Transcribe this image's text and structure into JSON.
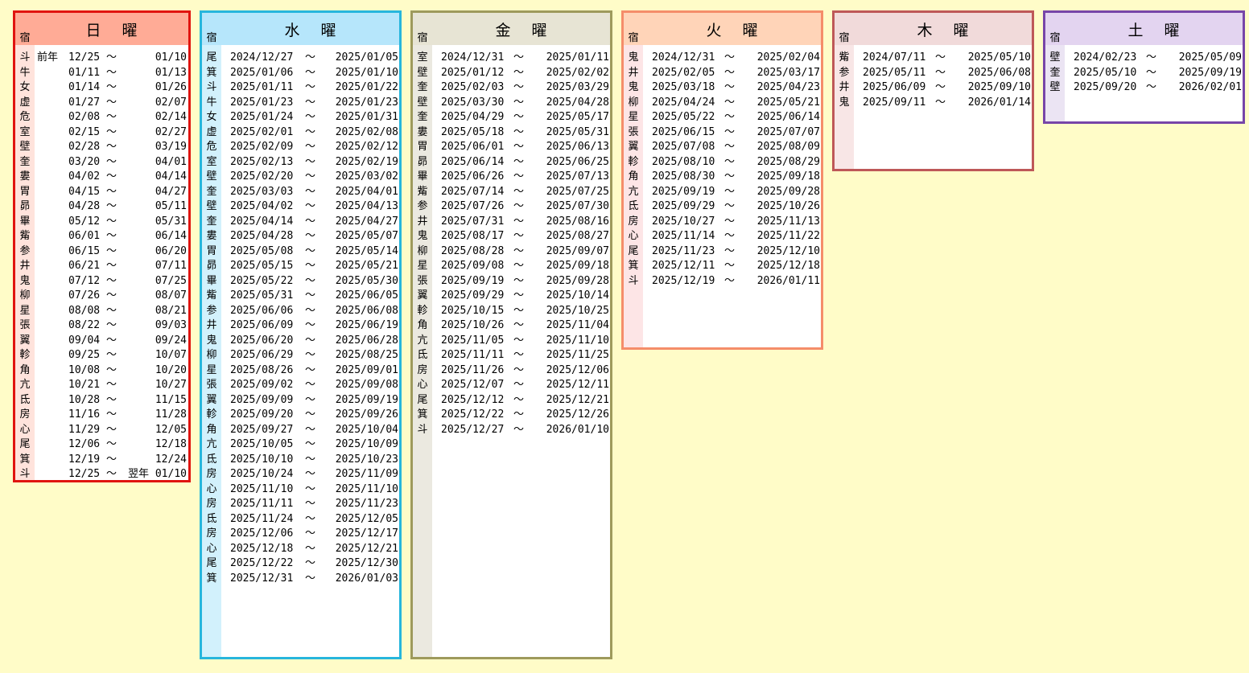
{
  "labels": {
    "syuku": "宿",
    "tilde": "〜"
  },
  "colors": {
    "background": "#fffcc8",
    "sunday": {
      "border": "#e0140f",
      "header": "#ffab96",
      "stripe": "#ffe3dc"
    },
    "wednesday": {
      "border": "#27b6dc",
      "header": "#b6e6fb",
      "stripe": "#d2f1fc"
    },
    "friday": {
      "border": "#9e9a5c",
      "header": "#e7e4d4",
      "stripe": "#ebe9e0"
    },
    "tuesday": {
      "border": "#f58d6a",
      "header": "#ffd4b8",
      "stripe": "#fde5e6"
    },
    "thursday": {
      "border": "#be5858",
      "header": "#f1dada",
      "stripe": "#f8e6e6"
    },
    "saturday": {
      "border": "#7745a8",
      "header": "#e3d4f0",
      "stripe": "#ebe4f3"
    }
  },
  "sunday": {
    "title": "日曜",
    "rows": [
      {
        "m": "斗",
        "pre": "前年",
        "s": "12/25 〜",
        "e": "01/10"
      },
      {
        "m": "牛",
        "pre": "",
        "s": "01/11 〜",
        "e": "01/13"
      },
      {
        "m": "女",
        "pre": "",
        "s": "01/14 〜",
        "e": "01/26"
      },
      {
        "m": "虚",
        "pre": "",
        "s": "01/27 〜",
        "e": "02/07"
      },
      {
        "m": "危",
        "pre": "",
        "s": "02/08 〜",
        "e": "02/14"
      },
      {
        "m": "室",
        "pre": "",
        "s": "02/15 〜",
        "e": "02/27"
      },
      {
        "m": "壁",
        "pre": "",
        "s": "02/28 〜",
        "e": "03/19"
      },
      {
        "m": "奎",
        "pre": "",
        "s": "03/20 〜",
        "e": "04/01"
      },
      {
        "m": "婁",
        "pre": "",
        "s": "04/02 〜",
        "e": "04/14"
      },
      {
        "m": "胃",
        "pre": "",
        "s": "04/15 〜",
        "e": "04/27"
      },
      {
        "m": "昴",
        "pre": "",
        "s": "04/28 〜",
        "e": "05/11"
      },
      {
        "m": "畢",
        "pre": "",
        "s": "05/12 〜",
        "e": "05/31"
      },
      {
        "m": "觜",
        "pre": "",
        "s": "06/01 〜",
        "e": "06/14"
      },
      {
        "m": "参",
        "pre": "",
        "s": "06/15 〜",
        "e": "06/20"
      },
      {
        "m": "井",
        "pre": "",
        "s": "06/21 〜",
        "e": "07/11"
      },
      {
        "m": "鬼",
        "pre": "",
        "s": "07/12 〜",
        "e": "07/25"
      },
      {
        "m": "柳",
        "pre": "",
        "s": "07/26 〜",
        "e": "08/07"
      },
      {
        "m": "星",
        "pre": "",
        "s": "08/08 〜",
        "e": "08/21"
      },
      {
        "m": "張",
        "pre": "",
        "s": "08/22 〜",
        "e": "09/03"
      },
      {
        "m": "翼",
        "pre": "",
        "s": "09/04 〜",
        "e": "09/24"
      },
      {
        "m": "軫",
        "pre": "",
        "s": "09/25 〜",
        "e": "10/07"
      },
      {
        "m": "角",
        "pre": "",
        "s": "10/08 〜",
        "e": "10/20"
      },
      {
        "m": "亢",
        "pre": "",
        "s": "10/21 〜",
        "e": "10/27"
      },
      {
        "m": "氐",
        "pre": "",
        "s": "10/28 〜",
        "e": "11/15"
      },
      {
        "m": "房",
        "pre": "",
        "s": "11/16 〜",
        "e": "11/28"
      },
      {
        "m": "心",
        "pre": "",
        "s": "11/29 〜",
        "e": "12/05"
      },
      {
        "m": "尾",
        "pre": "",
        "s": "12/06 〜",
        "e": "12/18"
      },
      {
        "m": "箕",
        "pre": "",
        "s": "12/19 〜",
        "e": "12/24"
      },
      {
        "m": "斗",
        "pre": "",
        "s": "12/25 〜",
        "e": "翌年 01/10"
      }
    ]
  },
  "wednesday": {
    "title": "水曜",
    "rows": [
      {
        "m": "尾",
        "s": "2024/12/27",
        "e": "2025/01/05"
      },
      {
        "m": "箕",
        "s": "2025/01/06",
        "e": "2025/01/10"
      },
      {
        "m": "斗",
        "s": "2025/01/11",
        "e": "2025/01/22"
      },
      {
        "m": "牛",
        "s": "2025/01/23",
        "e": "2025/01/23"
      },
      {
        "m": "女",
        "s": "2025/01/24",
        "e": "2025/01/31"
      },
      {
        "m": "虚",
        "s": "2025/02/01",
        "e": "2025/02/08"
      },
      {
        "m": "危",
        "s": "2025/02/09",
        "e": "2025/02/12"
      },
      {
        "m": "室",
        "s": "2025/02/13",
        "e": "2025/02/19"
      },
      {
        "m": "壁",
        "s": "2025/02/20",
        "e": "2025/03/02"
      },
      {
        "m": "奎",
        "s": "2025/03/03",
        "e": "2025/04/01"
      },
      {
        "m": "壁",
        "s": "2025/04/02",
        "e": "2025/04/13"
      },
      {
        "m": "奎",
        "s": "2025/04/14",
        "e": "2025/04/27"
      },
      {
        "m": "婁",
        "s": "2025/04/28",
        "e": "2025/05/07"
      },
      {
        "m": "胃",
        "s": "2025/05/08",
        "e": "2025/05/14"
      },
      {
        "m": "昴",
        "s": "2025/05/15",
        "e": "2025/05/21"
      },
      {
        "m": "畢",
        "s": "2025/05/22",
        "e": "2025/05/30"
      },
      {
        "m": "觜",
        "s": "2025/05/31",
        "e": "2025/06/05"
      },
      {
        "m": "参",
        "s": "2025/06/06",
        "e": "2025/06/08"
      },
      {
        "m": "井",
        "s": "2025/06/09",
        "e": "2025/06/19"
      },
      {
        "m": "鬼",
        "s": "2025/06/20",
        "e": "2025/06/28"
      },
      {
        "m": "柳",
        "s": "2025/06/29",
        "e": "2025/08/25"
      },
      {
        "m": "星",
        "s": "2025/08/26",
        "e": "2025/09/01"
      },
      {
        "m": "張",
        "s": "2025/09/02",
        "e": "2025/09/08"
      },
      {
        "m": "翼",
        "s": "2025/09/09",
        "e": "2025/09/19"
      },
      {
        "m": "軫",
        "s": "2025/09/20",
        "e": "2025/09/26"
      },
      {
        "m": "角",
        "s": "2025/09/27",
        "e": "2025/10/04"
      },
      {
        "m": "亢",
        "s": "2025/10/05",
        "e": "2025/10/09"
      },
      {
        "m": "氐",
        "s": "2025/10/10",
        "e": "2025/10/23"
      },
      {
        "m": "房",
        "s": "2025/10/24",
        "e": "2025/11/09"
      },
      {
        "m": "心",
        "s": "2025/11/10",
        "e": "2025/11/10"
      },
      {
        "m": "房",
        "s": "2025/11/11",
        "e": "2025/11/23"
      },
      {
        "m": "氐",
        "s": "2025/11/24",
        "e": "2025/12/05"
      },
      {
        "m": "房",
        "s": "2025/12/06",
        "e": "2025/12/17"
      },
      {
        "m": "心",
        "s": "2025/12/18",
        "e": "2025/12/21"
      },
      {
        "m": "尾",
        "s": "2025/12/22",
        "e": "2025/12/30"
      },
      {
        "m": "箕",
        "s": "2025/12/31",
        "e": "2026/01/03"
      }
    ]
  },
  "friday": {
    "title": "金曜",
    "rows": [
      {
        "m": "室",
        "s": "2024/12/31",
        "e": "2025/01/11"
      },
      {
        "m": "壁",
        "s": "2025/01/12",
        "e": "2025/02/02"
      },
      {
        "m": "奎",
        "s": "2025/02/03",
        "e": "2025/03/29"
      },
      {
        "m": "壁",
        "s": "2025/03/30",
        "e": "2025/04/28"
      },
      {
        "m": "奎",
        "s": "2025/04/29",
        "e": "2025/05/17"
      },
      {
        "m": "婁",
        "s": "2025/05/18",
        "e": "2025/05/31"
      },
      {
        "m": "胃",
        "s": "2025/06/01",
        "e": "2025/06/13"
      },
      {
        "m": "昴",
        "s": "2025/06/14",
        "e": "2025/06/25"
      },
      {
        "m": "畢",
        "s": "2025/06/26",
        "e": "2025/07/13"
      },
      {
        "m": "觜",
        "s": "2025/07/14",
        "e": "2025/07/25"
      },
      {
        "m": "参",
        "s": "2025/07/26",
        "e": "2025/07/30"
      },
      {
        "m": "井",
        "s": "2025/07/31",
        "e": "2025/08/16"
      },
      {
        "m": "鬼",
        "s": "2025/08/17",
        "e": "2025/08/27"
      },
      {
        "m": "柳",
        "s": "2025/08/28",
        "e": "2025/09/07"
      },
      {
        "m": "星",
        "s": "2025/09/08",
        "e": "2025/09/18"
      },
      {
        "m": "張",
        "s": "2025/09/19",
        "e": "2025/09/28"
      },
      {
        "m": "翼",
        "s": "2025/09/29",
        "e": "2025/10/14"
      },
      {
        "m": "軫",
        "s": "2025/10/15",
        "e": "2025/10/25"
      },
      {
        "m": "角",
        "s": "2025/10/26",
        "e": "2025/11/04"
      },
      {
        "m": "亢",
        "s": "2025/11/05",
        "e": "2025/11/10"
      },
      {
        "m": "氐",
        "s": "2025/11/11",
        "e": "2025/11/25"
      },
      {
        "m": "房",
        "s": "2025/11/26",
        "e": "2025/12/06"
      },
      {
        "m": "心",
        "s": "2025/12/07",
        "e": "2025/12/11"
      },
      {
        "m": "尾",
        "s": "2025/12/12",
        "e": "2025/12/21"
      },
      {
        "m": "箕",
        "s": "2025/12/22",
        "e": "2025/12/26"
      },
      {
        "m": "斗",
        "s": "2025/12/27",
        "e": "2026/01/10"
      }
    ]
  },
  "tuesday": {
    "title": "火曜",
    "rows": [
      {
        "m": "鬼",
        "s": "2024/12/31",
        "e": "2025/02/04"
      },
      {
        "m": "井",
        "s": "2025/02/05",
        "e": "2025/03/17"
      },
      {
        "m": "鬼",
        "s": "2025/03/18",
        "e": "2025/04/23"
      },
      {
        "m": "柳",
        "s": "2025/04/24",
        "e": "2025/05/21"
      },
      {
        "m": "星",
        "s": "2025/05/22",
        "e": "2025/06/14"
      },
      {
        "m": "張",
        "s": "2025/06/15",
        "e": "2025/07/07"
      },
      {
        "m": "翼",
        "s": "2025/07/08",
        "e": "2025/08/09"
      },
      {
        "m": "軫",
        "s": "2025/08/10",
        "e": "2025/08/29"
      },
      {
        "m": "角",
        "s": "2025/08/30",
        "e": "2025/09/18"
      },
      {
        "m": "亢",
        "s": "2025/09/19",
        "e": "2025/09/28"
      },
      {
        "m": "氐",
        "s": "2025/09/29",
        "e": "2025/10/26"
      },
      {
        "m": "房",
        "s": "2025/10/27",
        "e": "2025/11/13"
      },
      {
        "m": "心",
        "s": "2025/11/14",
        "e": "2025/11/22"
      },
      {
        "m": "尾",
        "s": "2025/11/23",
        "e": "2025/12/10"
      },
      {
        "m": "箕",
        "s": "2025/12/11",
        "e": "2025/12/18"
      },
      {
        "m": "斗",
        "s": "2025/12/19",
        "e": "2026/01/11"
      }
    ]
  },
  "thursday": {
    "title": "木曜",
    "rows": [
      {
        "m": "觜",
        "s": "2024/07/11",
        "e": "2025/05/10"
      },
      {
        "m": "参",
        "s": "2025/05/11",
        "e": "2025/06/08"
      },
      {
        "m": "井",
        "s": "2025/06/09",
        "e": "2025/09/10"
      },
      {
        "m": "鬼",
        "s": "2025/09/11",
        "e": "2026/01/14"
      }
    ]
  },
  "saturday": {
    "title": "土曜",
    "rows": [
      {
        "m": "壁",
        "s": "2024/02/23",
        "e": "2025/05/09"
      },
      {
        "m": "奎",
        "s": "2025/05/10",
        "e": "2025/09/19"
      },
      {
        "m": "壁",
        "s": "2025/09/20",
        "e": "2026/02/01"
      }
    ]
  }
}
